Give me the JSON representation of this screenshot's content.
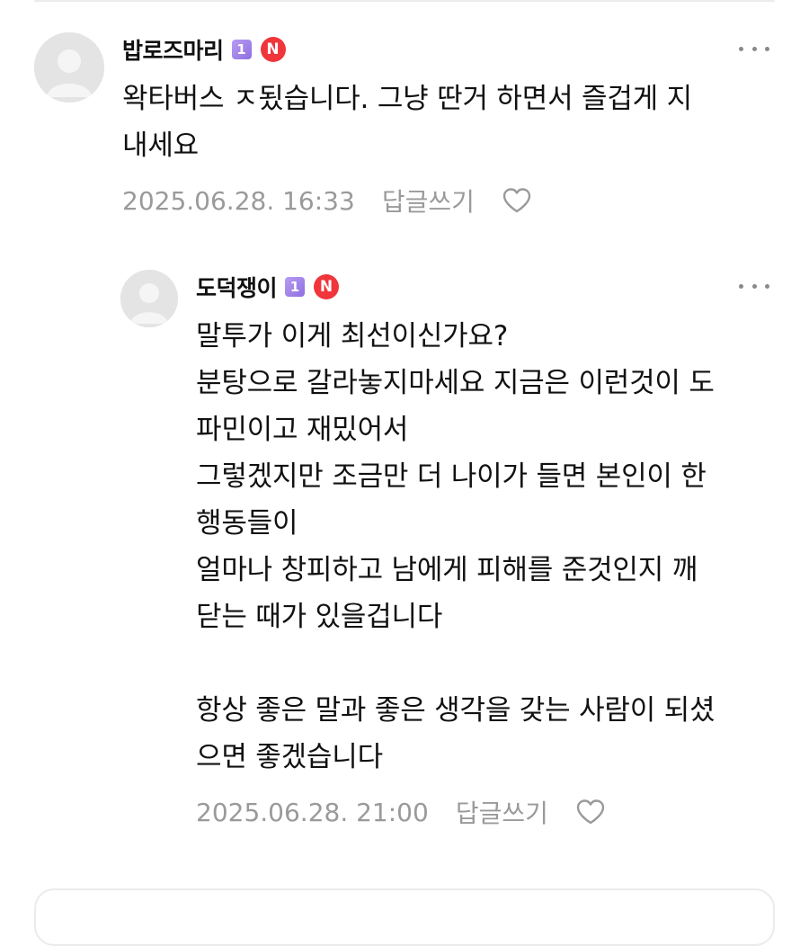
{
  "comments": [
    {
      "username": "밥로즈마리",
      "level_badge": "1",
      "new_badge": "N",
      "text": "왁타버스 ㅈ됬습니다. 그냥 딴거 하면서 즐겁게 지\n내세요",
      "timestamp": "2025.06.28. 16:33",
      "reply_label": "답글쓰기",
      "icons": {
        "avatar": "default-avatar",
        "like": "heart-outline-icon",
        "more": "more-dots-icon"
      }
    },
    {
      "username": "도덕쟁이",
      "level_badge": "1",
      "new_badge": "N",
      "text": "말투가 이게 최선이신가요?\n분탕으로 갈라놓지마세요 지금은 이런것이 도\n파민이고 재밌어서\n그렇겠지만 조금만 더 나이가 들면 본인이 한\n행동들이\n얼마나 창피하고 남에게 피해를 준것인지 깨\n닫는 때가 있을겁니다\n\n항상 좋은 말과 좋은 생각을 갖는 사람이 되셨\n으면 좋겠습니다",
      "timestamp": "2025.06.28. 21:00",
      "reply_label": "답글쓰기",
      "icons": {
        "avatar": "default-avatar",
        "like": "heart-outline-icon",
        "more": "more-dots-icon"
      }
    }
  ],
  "colors": {
    "level_badge": "#9d7fe8",
    "new_badge": "#f0353b",
    "meta_text": "#9a9a9a"
  }
}
